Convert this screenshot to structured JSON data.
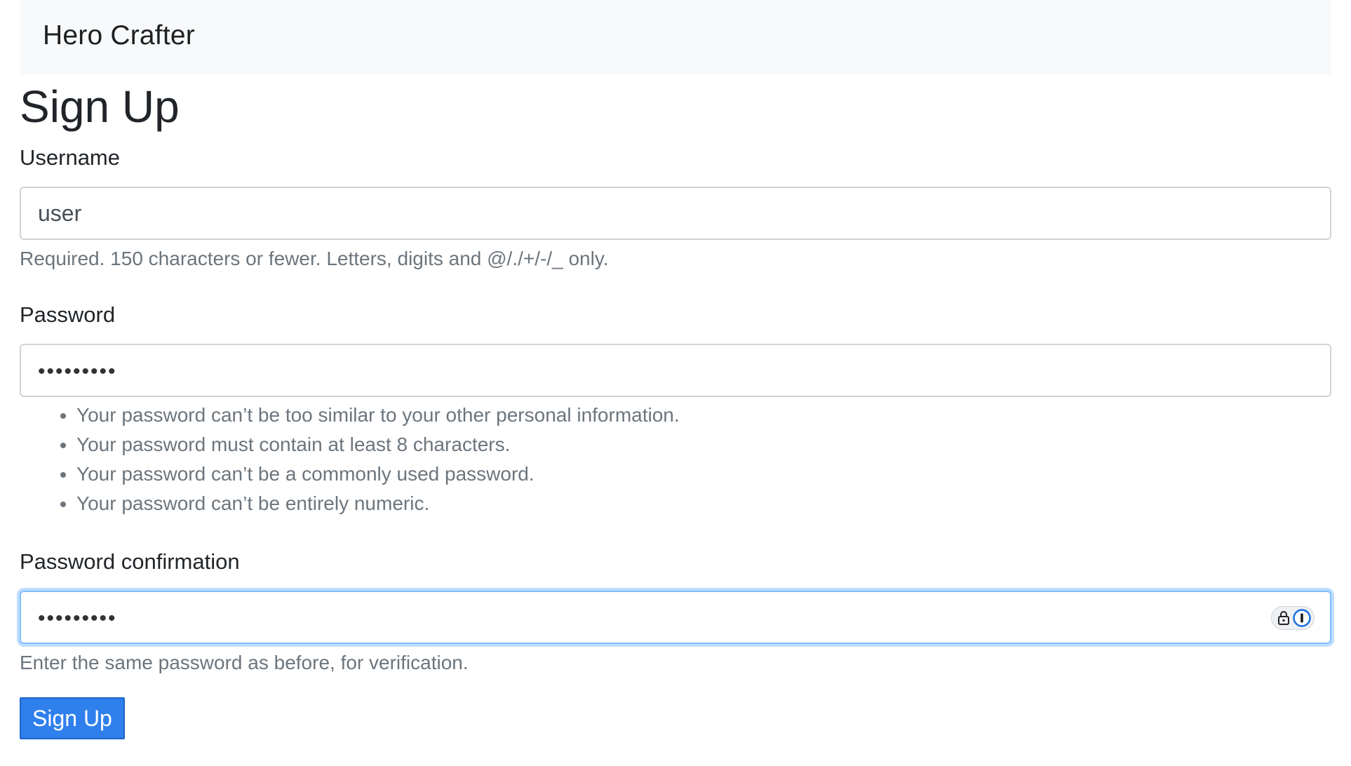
{
  "navbar": {
    "brand": "Hero Crafter"
  },
  "page": {
    "title": "Sign Up"
  },
  "form": {
    "username": {
      "label": "Username",
      "value": "user",
      "help": "Required. 150 characters or fewer. Letters, digits and @/./+/-/_ only."
    },
    "password": {
      "label": "Password",
      "masked_value": "•••••••••",
      "help_items": [
        "Your password can’t be too similar to your other personal information.",
        "Your password must contain at least 8 characters.",
        "Your password can’t be a commonly used password.",
        "Your password can’t be entirely numeric."
      ]
    },
    "password_confirmation": {
      "label": "Password confirmation",
      "masked_value": "•••••••••",
      "help": "Enter the same password as before, for verification.",
      "extension_icons": [
        "lock-icon",
        "password-manager-icon"
      ]
    },
    "submit_label": "Sign Up"
  },
  "colors": {
    "navbar_bg": "#f8f9fa",
    "button_bg": "#2f80ed",
    "focus_border": "#80bdff",
    "help_text": "#6c757d"
  }
}
